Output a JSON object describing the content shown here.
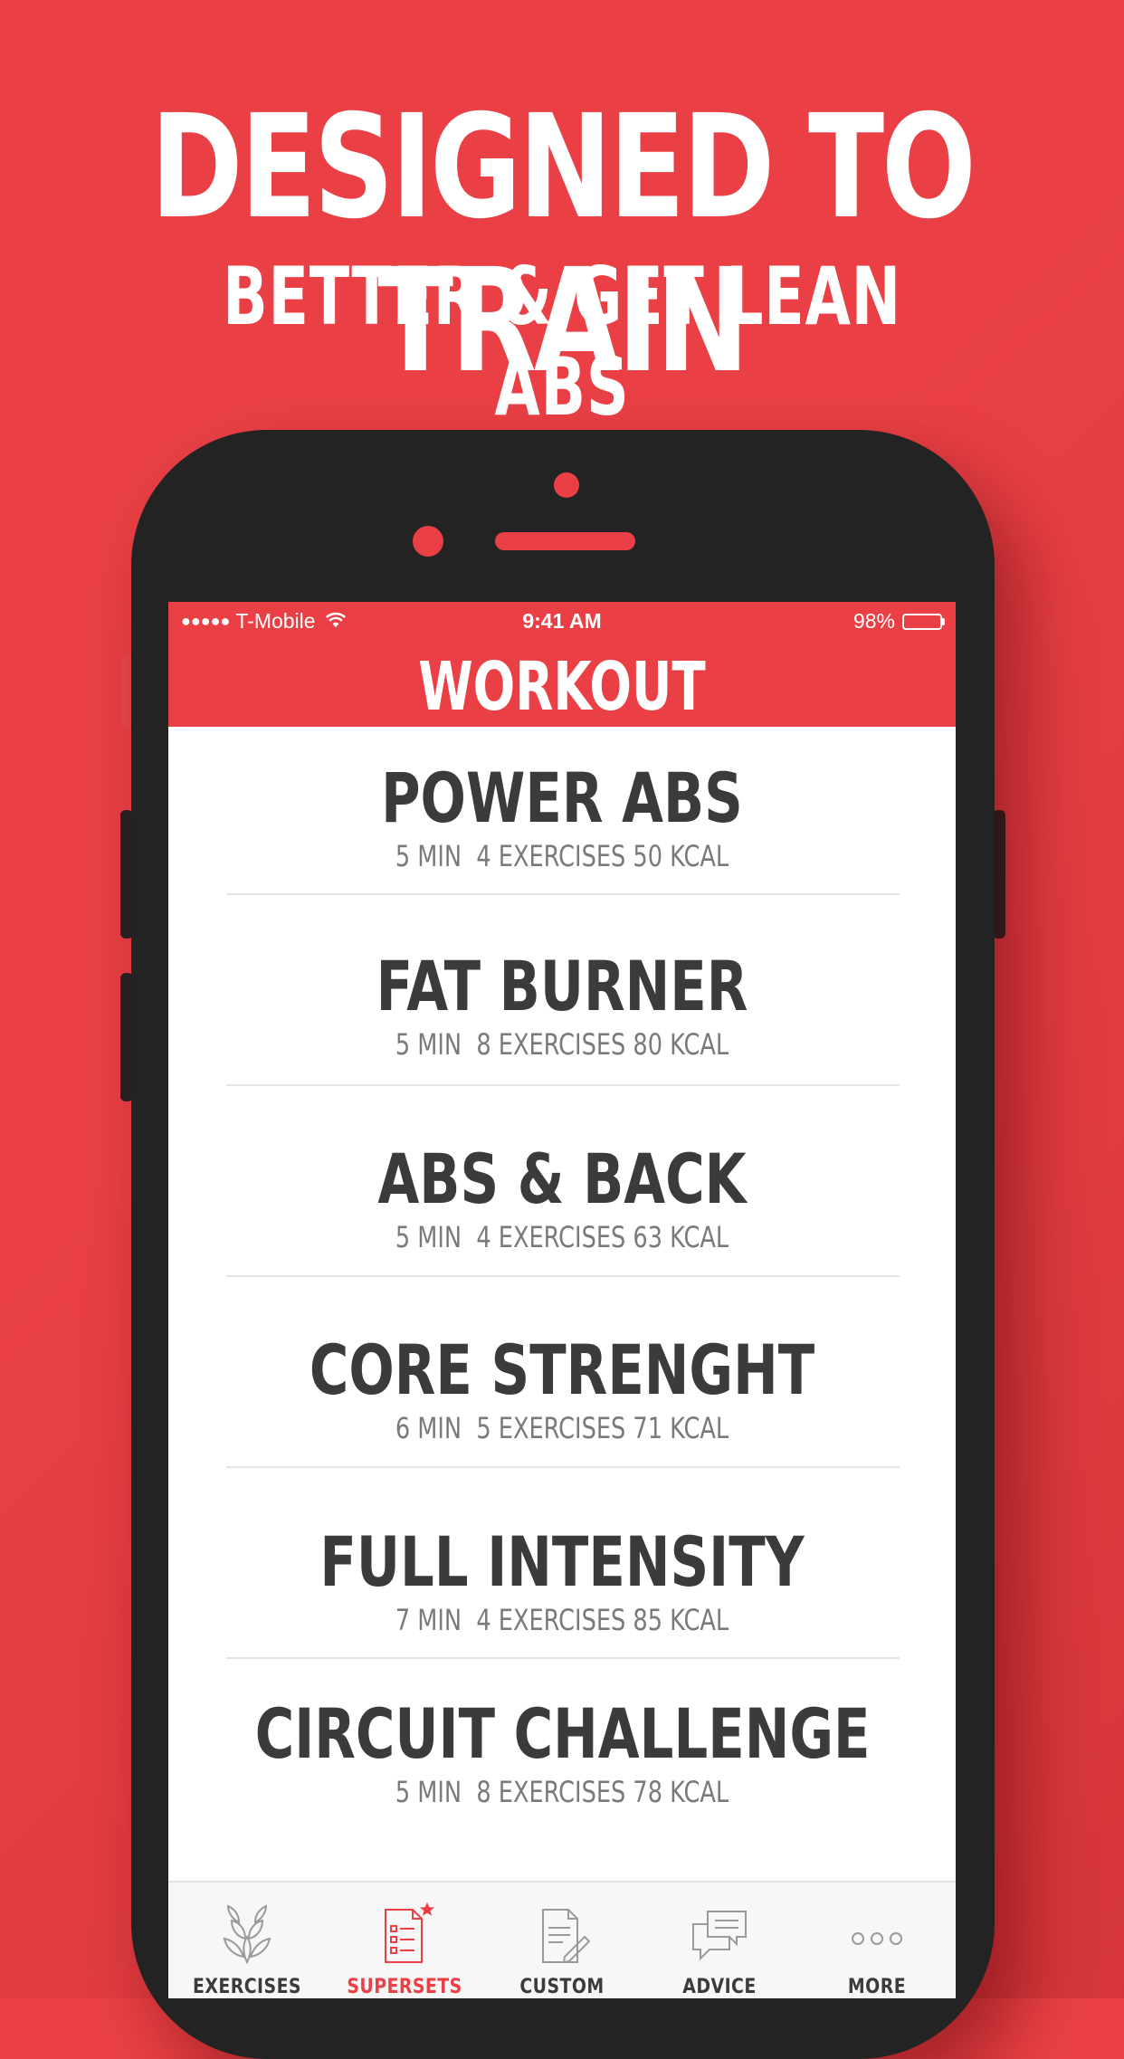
{
  "promo": {
    "headline": "DESIGNED TO TRAIN",
    "subheadline": "BETTER & GET LEAN ABS"
  },
  "colors": {
    "brand": "#ea4045",
    "phone_body": "#232323",
    "text_dark": "#3b3b3b",
    "text_muted": "#7a7a7a"
  },
  "status_bar": {
    "signal": "●●●●●",
    "carrier": "T-Mobile",
    "time": "9:41 AM",
    "battery": "98%",
    "battery_level": 0.98
  },
  "nav": {
    "title": "WORKOUT"
  },
  "workouts": [
    {
      "name": "POWER ABS",
      "meta": "5 MIN  4 EXERCISES 50 KCAL"
    },
    {
      "name": "FAT BURNER",
      "meta": "5 MIN  8 EXERCISES 80 KCAL"
    },
    {
      "name": "ABS & BACK",
      "meta": "5 MIN  4 EXERCISES 63 KCAL"
    },
    {
      "name": "CORE STRENGHT",
      "meta": "6 MIN  5 EXERCISES 71 KCAL"
    },
    {
      "name": "FULL INTENSITY",
      "meta": "7 MIN  4 EXERCISES 85 KCAL"
    },
    {
      "name": "CIRCUIT CHALLENGE",
      "meta": "5 MIN  8 EXERCISES 78 KCAL"
    }
  ],
  "tabs": [
    {
      "label": "EXERCISES",
      "icon": "leaf-abs-icon",
      "active": false
    },
    {
      "label": "SUPERSETS",
      "icon": "clipboard-list-star-icon",
      "active": true
    },
    {
      "label": "CUSTOM",
      "icon": "document-pencil-icon",
      "active": false
    },
    {
      "label": "ADVICE",
      "icon": "chat-bubbles-icon",
      "active": false
    },
    {
      "label": "MORE",
      "icon": "more-dots-icon",
      "active": false
    }
  ]
}
